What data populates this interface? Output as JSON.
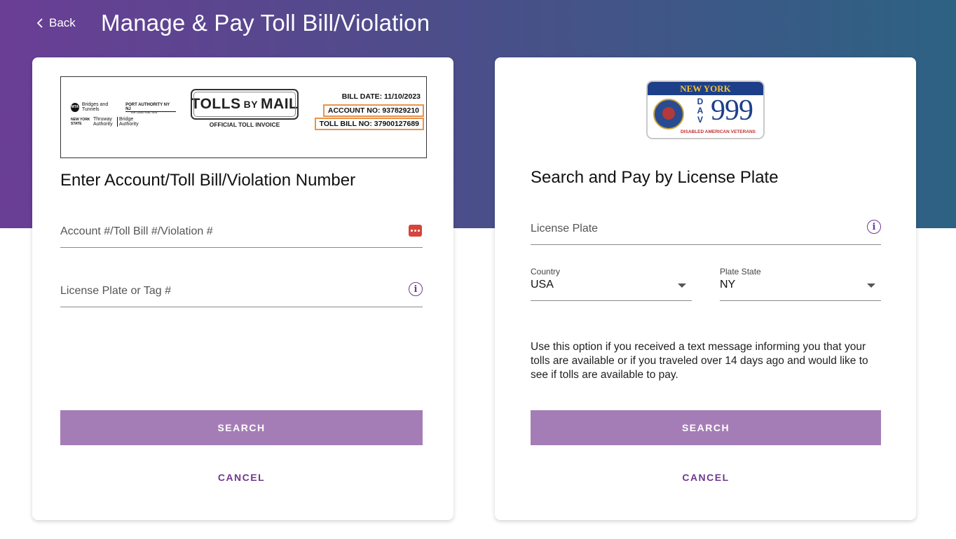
{
  "header": {
    "back_label": "Back",
    "title": "Manage & Pay Toll Bill/Violation"
  },
  "left_card": {
    "invoice": {
      "logos": {
        "mta": "MTA",
        "bridges_tunnels": "Bridges and Tunnels",
        "port_authority": "PORT AUTHORITY NY NJ",
        "air_land_rail_sea": "AIR LAND RAIL SEA",
        "ny_state": "NEW YORK STATE",
        "thruway": "Thruway Authority",
        "bridge": "Bridge Authority"
      },
      "tolls_big": "TOLLS",
      "tolls_by": "BY",
      "tolls_mail": "MAIL",
      "official": "OFFICIAL TOLL INVOICE",
      "bill_date": "BILL DATE: 11/10/2023",
      "account_no": "ACCOUNT NO: 937829210",
      "toll_bill_no": "TOLL BILL NO: 37900127689"
    },
    "title": "Enter Account/Toll Bill/Violation Number",
    "account_field": {
      "placeholder": "Account #/Toll Bill #/Violation #",
      "value": ""
    },
    "plate_field": {
      "placeholder": "License Plate or Tag #",
      "value": ""
    },
    "search_label": "SEARCH",
    "cancel_label": "CANCEL"
  },
  "right_card": {
    "plate_image": {
      "state": "NEW YORK",
      "letters": [
        "D",
        "A",
        "V"
      ],
      "number": "999",
      "caption": "DISABLED AMERICAN VETERANS"
    },
    "title": "Search and Pay by License Plate",
    "plate_field": {
      "placeholder": "License Plate",
      "value": ""
    },
    "country": {
      "label": "Country",
      "value": "USA"
    },
    "plate_state": {
      "label": "Plate State",
      "value": "NY"
    },
    "note": "Use this option if you received a text message informing you that your tolls are available or if you traveled over 14 days ago and would like to see if tolls are available to pay.",
    "search_label": "SEARCH",
    "cancel_label": "CANCEL"
  },
  "colors": {
    "banner_start": "#6a3e95",
    "banner_end": "#2d6283",
    "button": "#a57db6",
    "accent": "#6e3a96",
    "highlight_box": "#e8934a"
  },
  "icons": [
    "back-chevron-icon",
    "password-manager-icon",
    "info-icon",
    "chevron-down-icon"
  ]
}
